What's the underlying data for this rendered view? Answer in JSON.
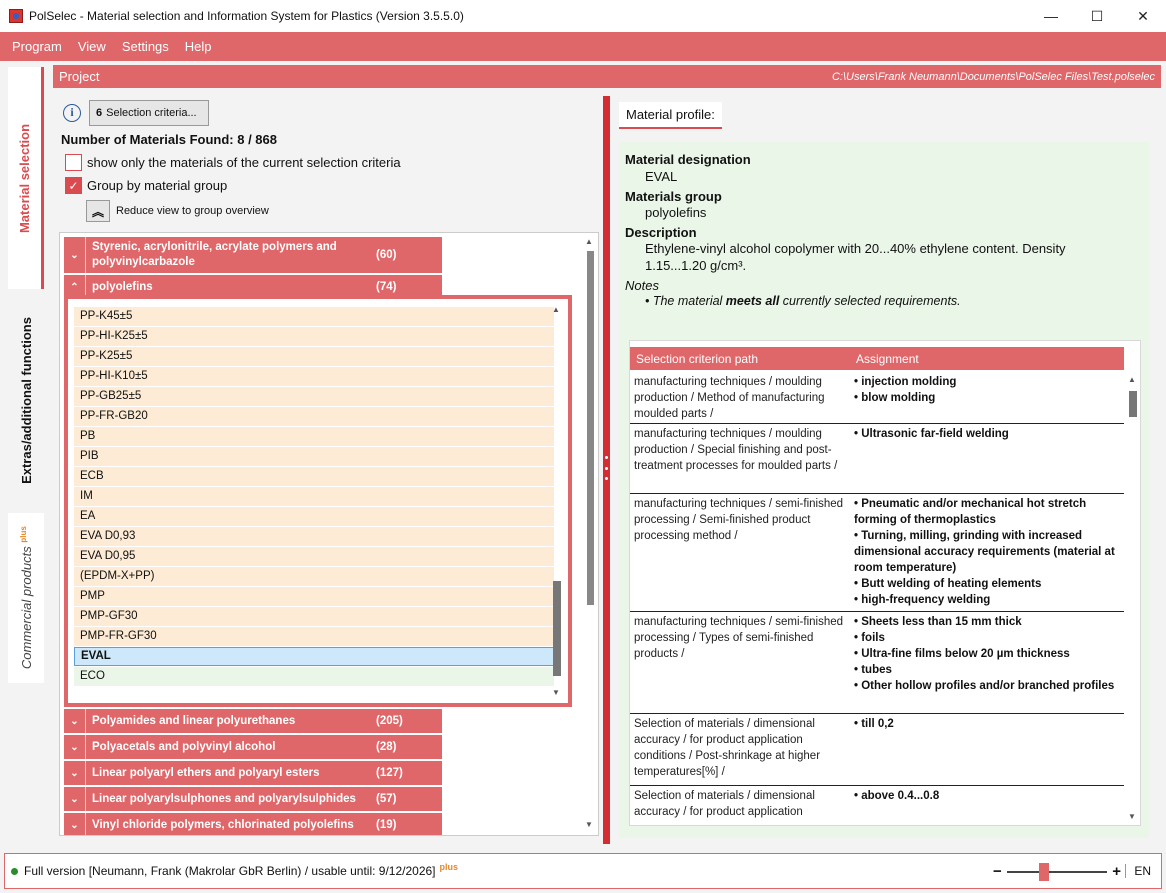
{
  "window": {
    "title": "PolSelec - Material selection and Information System for Plastics (Version 3.5.5.0)",
    "minimize": "—",
    "maximize": "☐",
    "close": "✕"
  },
  "menu": [
    "Program",
    "View",
    "Settings",
    "Help"
  ],
  "side_tabs": {
    "material_selection": "Material selection",
    "extras": "Extras/additional functions",
    "commercial": "Commercial products",
    "commercial_sup": "plus"
  },
  "project": {
    "label": "Project",
    "path": "C:\\Users\\Frank Neumann\\Documents\\PolSelec Files\\Test.polselec"
  },
  "selection": {
    "info_icon": "i",
    "criteria_count": "6",
    "criteria_label": "Selection criteria...",
    "found_label": "Number of Materials Found: 8 / 868",
    "show_only_label": "show only the materials of the current selection criteria",
    "show_only_checked": false,
    "group_by_label": "Group by material group",
    "group_by_checked": true,
    "reduce_label": "Reduce view to group overview"
  },
  "groups_top": [
    {
      "name": "Styrenic, acrylonitrile, acrylate polymers and polyvinylcarbazole",
      "count": "(60)",
      "expanded": false
    },
    {
      "name": "polyolefins",
      "count": "(74)",
      "expanded": true
    }
  ],
  "polyolefin_items": [
    "PP-K45±5",
    "PP-HI-K25±5",
    "PP-K25±5",
    "PP-HI-K10±5",
    "PP-GB25±5",
    "PP-FR-GB20",
    "PB",
    "PIB",
    "ECB",
    "IM",
    "EA",
    "EVA D0,93",
    "EVA D0,95",
    "(EPDM-X+PP)",
    "PMP",
    "PMP-GF30",
    "PMP-FR-GF30",
    "EVAL",
    "ECO"
  ],
  "selected_item": "EVAL",
  "groups_bottom": [
    {
      "name": "Polyamides and linear polyurethanes",
      "count": "(205)"
    },
    {
      "name": "Polyacetals and polyvinyl alcohol",
      "count": "(28)"
    },
    {
      "name": "Linear polyaryl ethers and polyaryl esters",
      "count": "(127)"
    },
    {
      "name": "Linear polyarylsulphones and polyarylsulphides",
      "count": "(57)"
    },
    {
      "name": "Vinyl chloride polymers, chlorinated polyolefins",
      "count": "(19)"
    }
  ],
  "profile": {
    "tab": "Material profile:",
    "designation_label": "Material designation",
    "designation": "EVAL",
    "group_label": "Materials group",
    "group": "polyolefins",
    "description_label": "Description",
    "description": "Ethylene-vinyl alcohol copolymer with 20...40% ethylene content. Density 1.15...1.20 g/cm³.",
    "notes_label": "Notes",
    "note_pre": "• The material ",
    "note_bold": "meets all",
    "note_post": " currently selected requirements."
  },
  "criteria_table": {
    "col_path": "Selection criterion path",
    "col_assignment": "Assignment",
    "rows": [
      {
        "path": "manufacturing techniques / moulding production / Method of manufacturing moulded parts /",
        "assignment": [
          "• injection molding",
          "• blow molding"
        ]
      },
      {
        "path": "manufacturing techniques / moulding production / Special finishing and post-treatment processes for moulded parts /",
        "assignment": [
          "• Ultrasonic far-field welding"
        ]
      },
      {
        "path": "manufacturing techniques / semi-finished processing / Semi-finished product processing method /",
        "assignment": [
          "• Pneumatic and/or mechanical hot stretch forming of thermoplastics",
          "• Turning, milling, grinding with increased dimensional accuracy requirements (material at room temperature)",
          "• Butt welding of heating elements",
          "• high-frequency welding"
        ]
      },
      {
        "path": "manufacturing techniques / semi-finished processing / Types of semi-finished products /",
        "assignment": [
          "• Sheets less than 15 mm thick",
          "• foils",
          "• Ultra-fine films below 20 µm thickness",
          "• tubes",
          "• Other hollow profiles and/or branched profiles"
        ]
      },
      {
        "path": "Selection of materials / dimensional accuracy / for product application conditions / Post-shrinkage at higher temperatures[%] /",
        "assignment": [
          "• till 0,2"
        ]
      },
      {
        "path": "Selection of materials / dimensional accuracy / for product application",
        "assignment": [
          "• above 0.4...0.8"
        ]
      }
    ]
  },
  "status": {
    "text": "Full version [Neumann, Frank (Makrolar GbR Berlin) / usable until: 9/12/2026]",
    "plus": "plus",
    "zoom_minus": "−",
    "zoom_plus": "+",
    "zoom_level": 0.36,
    "language": "EN"
  },
  "colors": {
    "accent": "#df6669",
    "accent_dark": "#d42c33",
    "item_bg": "#fdebd5",
    "selected_bg": "#cde8fb",
    "profile_bg": "#eaf6e8"
  }
}
